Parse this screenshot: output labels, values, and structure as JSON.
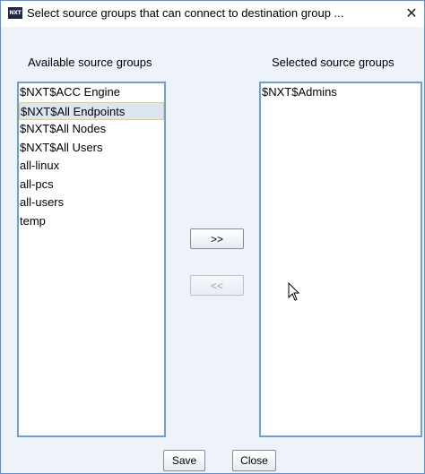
{
  "window": {
    "title": "Select source groups that can connect to destination group ...",
    "app_icon_text": "NXT",
    "close_glyph": "✕"
  },
  "available": {
    "label": "Available source groups",
    "items": [
      "$NXT$ACC Engine",
      "$NXT$All Endpoints",
      "$NXT$All Nodes",
      "$NXT$All Users",
      "all-linux",
      "all-pcs",
      "all-users",
      "temp"
    ],
    "selected_item": "$NXT$All Endpoints"
  },
  "selected": {
    "label": "Selected source groups",
    "items": [
      "$NXT$Admins"
    ]
  },
  "buttons": {
    "add_label": ">>",
    "remove_label": "<<",
    "save_label": "Save",
    "close_label": "Close"
  },
  "colors": {
    "list_border": "#6f9fd8",
    "selection_bg": "#dce6f2",
    "selection_border": "#e6cf6a",
    "dialog_bg": "#eef3f9"
  }
}
